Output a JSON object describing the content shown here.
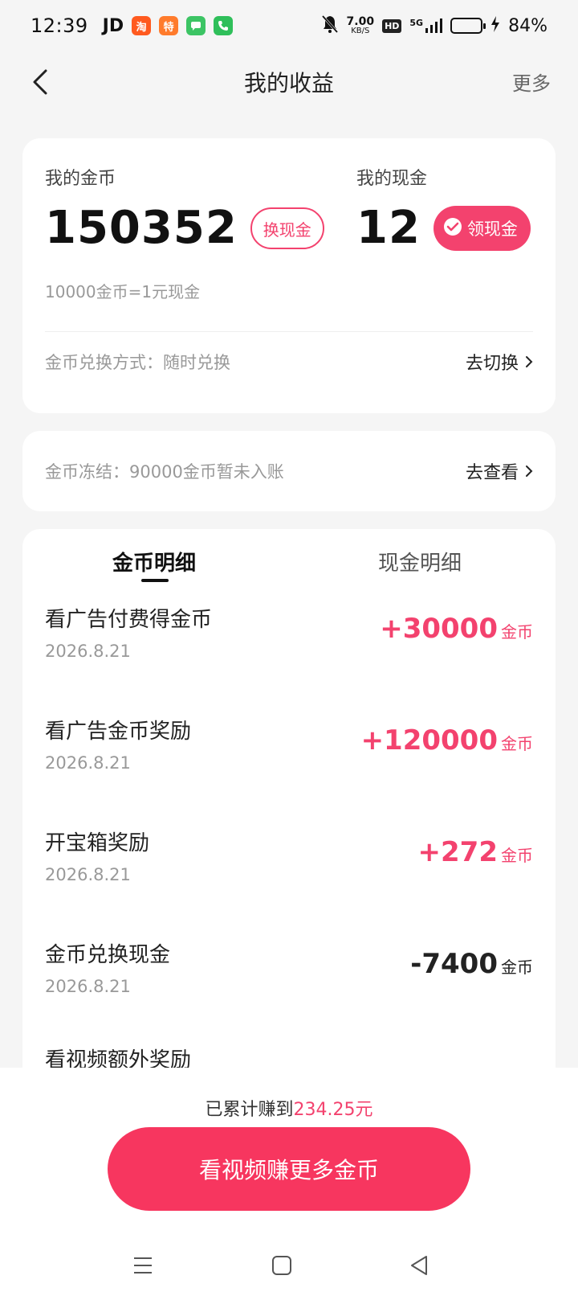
{
  "status_bar": {
    "time": "12:39",
    "carrier": "JD",
    "net_speed_value": "7.00",
    "net_speed_unit": "KB/S",
    "hd_label": "HD",
    "network": "5G",
    "battery_percent": "84%",
    "battery_level": 0.84,
    "app_icons": [
      "taobao-icon",
      "taobao-special-icon",
      "messages-icon",
      "phone-icon"
    ],
    "app_icon_labels": [
      "淘",
      "特"
    ]
  },
  "header": {
    "title": "我的收益",
    "more_label": "更多"
  },
  "earnings": {
    "coin_label": "我的金币",
    "coin_value": "150352",
    "exchange_button": "换现金",
    "cash_label": "我的现金",
    "cash_value": "12",
    "withdraw_button": "领现金",
    "rate_note": "10000金币=1元现金",
    "exchange_mode_label": "金币兑换方式：随时兑换",
    "exchange_mode_action": "去切换"
  },
  "freeze": {
    "label": "金币冻结：90000金币暂未入账",
    "action": "去查看"
  },
  "tabs": {
    "coin_detail": "金币明细",
    "cash_detail": "现金明细"
  },
  "transactions": [
    {
      "title": "看广告付费得金币",
      "date": "2026.8.21",
      "amount": "+30000",
      "unit": "金币",
      "positive": true
    },
    {
      "title": "看广告金币奖励",
      "date": "2026.8.21",
      "amount": "+120000",
      "unit": "金币",
      "positive": true
    },
    {
      "title": "开宝箱奖励",
      "date": "2026.8.21",
      "amount": "+272",
      "unit": "金币",
      "positive": true
    },
    {
      "title": "金币兑换现金",
      "date": "2026.8.21",
      "amount": "-7400",
      "unit": "金币",
      "positive": false
    }
  ],
  "partial_item_title": "看视频额外奖励",
  "footer": {
    "total_prefix": "已累计赚到",
    "total_amount": "234.25元",
    "cta_label": "看视频赚更多金币"
  },
  "colors": {
    "accent": "#f3426e",
    "cta": "#f7365f",
    "background": "#f5f5f5"
  }
}
